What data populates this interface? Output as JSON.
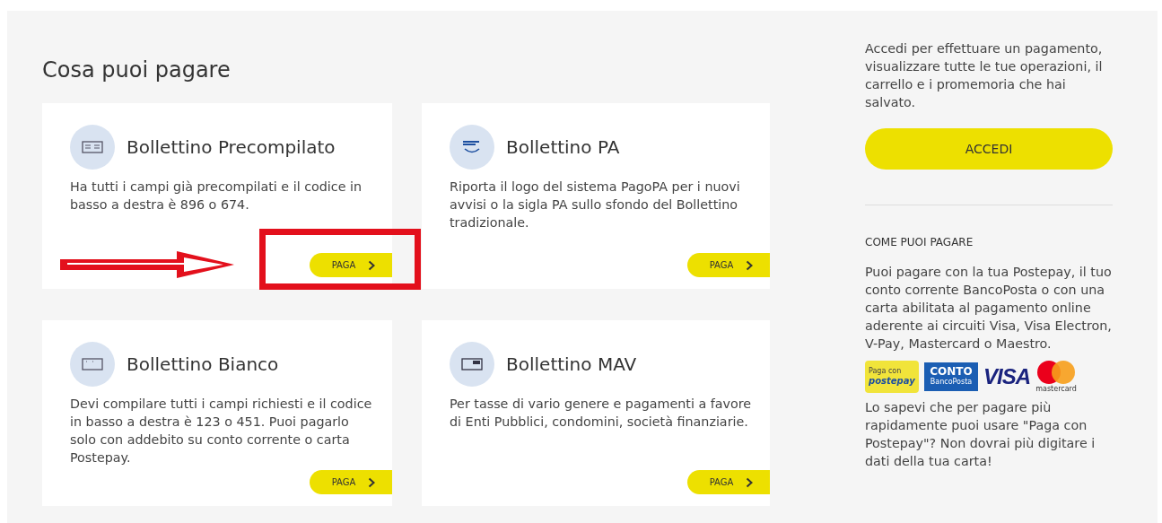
{
  "section_title": "Cosa puoi pagare",
  "cards": [
    {
      "kind": "precompilato",
      "title": "Bollettino Precompilato",
      "description": "Ha tutti i campi già precompilati e il codice in basso a destra è 896 o 674.",
      "button": "PAGA",
      "highlighted": true
    },
    {
      "kind": "pa",
      "title": "Bollettino PA",
      "description": "Riporta il logo del sistema PagoPA per i nuovi avvisi o la sigla PA sullo sfondo del Bollettino tradizionale.",
      "button": "PAGA",
      "highlighted": false
    },
    {
      "kind": "bianco",
      "title": "Bollettino Bianco",
      "description": "Devi compilare tutti i campi richiesti e il codice in basso a destra è 123 o 451. Puoi pagarlo solo con addebito su conto corrente o carta Postepay.",
      "button": "PAGA",
      "highlighted": false
    },
    {
      "kind": "mav",
      "title": "Bollettino MAV",
      "description": "Per tasse di vario genere e pagamenti a favore di Enti Pubblici, condomini, società finanziarie.",
      "button": "PAGA",
      "highlighted": false
    }
  ],
  "sidebar": {
    "login_text": "Accedi per effettuare un pagamento, visualizzare tutte le tue operazioni, il carrello e i promemoria che hai salvato.",
    "login_button": "ACCEDI",
    "heading": "COME PUOI PAGARE",
    "methods_text": "Puoi pagare con la tua Postepay, il tuo conto corrente BancoPosta o con una carta abilitata al pagamento online aderente ai circuiti Visa, Visa Electron, V-Pay, Mastercard o Maestro.",
    "payment_logos": [
      {
        "kind": "postepay",
        "lines": [
          "Paga con",
          "postepay"
        ]
      },
      {
        "kind": "bancoposta",
        "lines": [
          "CONTO",
          "BancoPosta"
        ]
      },
      {
        "kind": "visa",
        "lines": [
          "VISA"
        ]
      },
      {
        "kind": "mastercard",
        "lines": [
          "mastercard"
        ]
      }
    ],
    "tip_text": "Lo sapevi che per pagare più rapidamente puoi usare \"Paga con Postepay\"? Non dovrai più digitare i dati della tua carta!"
  }
}
